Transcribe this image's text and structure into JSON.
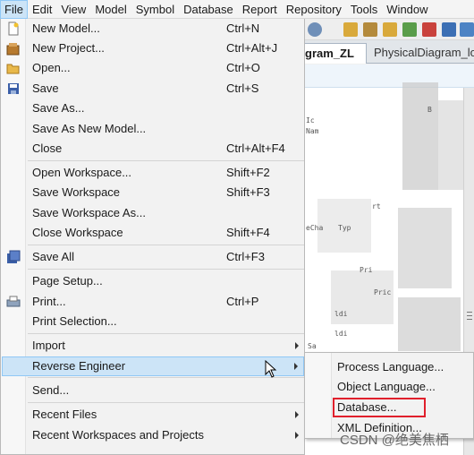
{
  "menubar": {
    "items": [
      "File",
      "Edit",
      "View",
      "Model",
      "Symbol",
      "Database",
      "Report",
      "Repository",
      "Tools",
      "Window"
    ]
  },
  "tabs": {
    "active": "gram_ZL",
    "inactive": "PhysicalDiagram_loca"
  },
  "file_menu": {
    "items": [
      {
        "label": "New Model...",
        "shortcut": "Ctrl+N",
        "icon": "new-model-icon"
      },
      {
        "label": "New Project...",
        "shortcut": "Ctrl+Alt+J",
        "icon": "new-project-icon"
      },
      {
        "label": "Open...",
        "shortcut": "Ctrl+O",
        "icon": "open-folder-icon"
      },
      {
        "label": "Save",
        "shortcut": "Ctrl+S",
        "icon": "save-icon"
      },
      {
        "label": "Save As...",
        "shortcut": ""
      },
      {
        "label": "Save As New Model...",
        "shortcut": ""
      },
      {
        "label": "Close",
        "shortcut": "Ctrl+Alt+F4"
      },
      {
        "label": "Open Workspace...",
        "shortcut": "Shift+F2"
      },
      {
        "label": "Save Workspace",
        "shortcut": "Shift+F3"
      },
      {
        "label": "Save Workspace As...",
        "shortcut": ""
      },
      {
        "label": "Close Workspace",
        "shortcut": "Shift+F4"
      },
      {
        "label": "Save All",
        "shortcut": "Ctrl+F3",
        "icon": "save-all-icon"
      },
      {
        "label": "Page Setup...",
        "shortcut": ""
      },
      {
        "label": "Print...",
        "shortcut": "Ctrl+P",
        "icon": "printer-icon"
      },
      {
        "label": "Print Selection...",
        "shortcut": ""
      },
      {
        "label": "Import",
        "shortcut": ""
      },
      {
        "label": "Reverse Engineer",
        "shortcut": ""
      },
      {
        "label": "Send...",
        "shortcut": ""
      },
      {
        "label": "Recent Files",
        "shortcut": ""
      },
      {
        "label": "Recent Workspaces and Projects",
        "shortcut": ""
      }
    ]
  },
  "reverse_engineer_submenu": {
    "items": [
      "Process Language...",
      "Object Language...",
      "Database...",
      "XML Definition..."
    ]
  },
  "canvas_fragments": [
    "Ic",
    "Nam",
    "rt",
    "eCha",
    "Typ",
    "Pri",
    "Pric",
    "ldi",
    "ldi",
    "Sa",
    "B"
  ],
  "watermark": "CSDN @绝美焦栖",
  "colors": {
    "highlight": "#cce4f7",
    "highlight_border": "#90c8f6",
    "annotation_box": "#e0202c"
  }
}
